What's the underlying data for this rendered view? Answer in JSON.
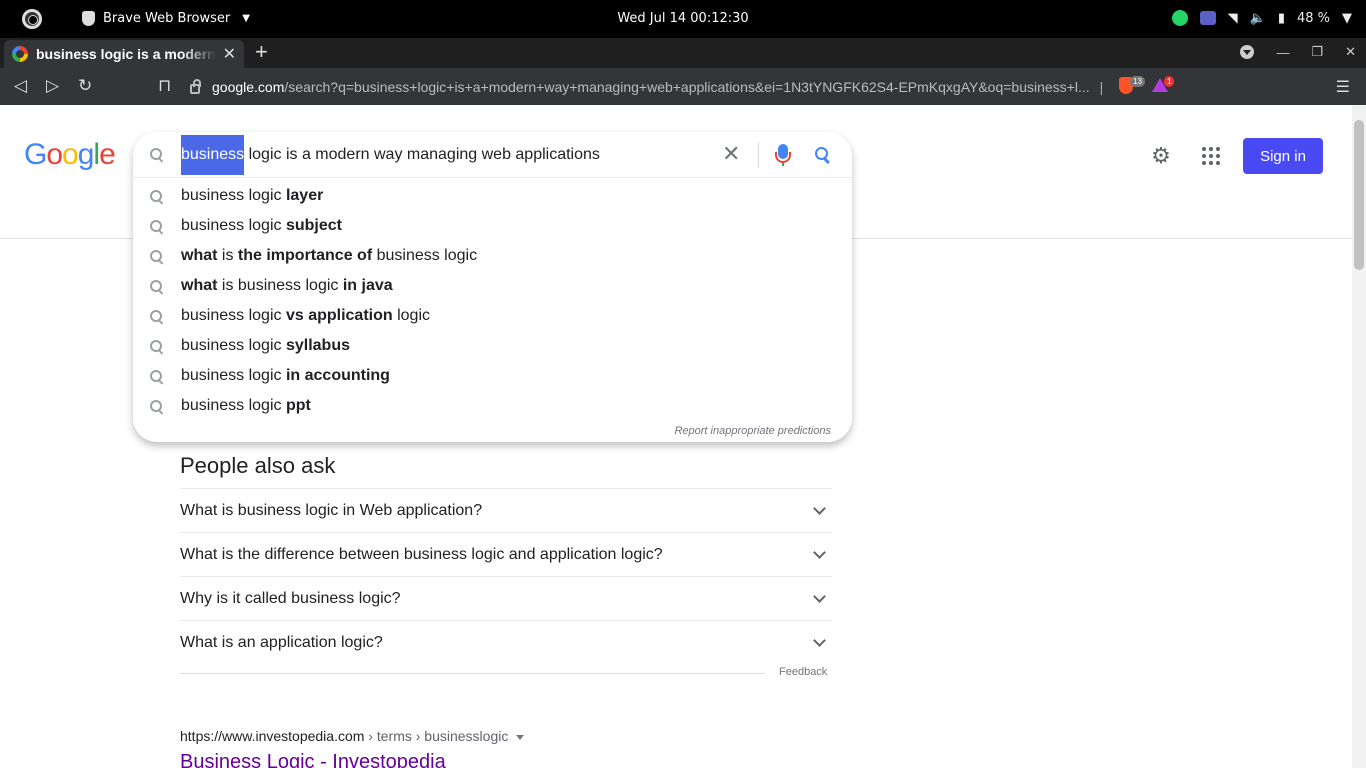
{
  "os": {
    "app_name": "Brave Web Browser",
    "clock": "Wed Jul 14  00:12:30",
    "battery": "48 %"
  },
  "browser": {
    "tab_title": "business logic is a modern way managing web applications",
    "url_host": "google.com",
    "url_rest": "/search?q=business+logic+is+a+modern+way+managing+web+applications&ei=1N3tYNGFK62S4-EPmKqxgAY&oq=business+l...",
    "shield_count": "13",
    "rewards_count": "1"
  },
  "google": {
    "logo_letters": [
      "G",
      "o",
      "o",
      "g",
      "l",
      "e"
    ],
    "sign_in": "Sign in",
    "query_selected": "business",
    "query_rest": " logic is a modern way managing web applications"
  },
  "suggestions": [
    {
      "parts": [
        {
          "t": "business logic ",
          "b": false
        },
        {
          "t": "layer",
          "b": true
        }
      ]
    },
    {
      "parts": [
        {
          "t": "business logic ",
          "b": false
        },
        {
          "t": "subject",
          "b": true
        }
      ]
    },
    {
      "parts": [
        {
          "t": "what",
          "b": true
        },
        {
          "t": " is ",
          "b": false
        },
        {
          "t": "the importance of",
          "b": true
        },
        {
          "t": " business logic",
          "b": false
        }
      ]
    },
    {
      "parts": [
        {
          "t": "what",
          "b": true
        },
        {
          "t": " is business logic ",
          "b": false
        },
        {
          "t": "in java",
          "b": true
        }
      ]
    },
    {
      "parts": [
        {
          "t": "business logic ",
          "b": false
        },
        {
          "t": "vs application",
          "b": true
        },
        {
          "t": " logic",
          "b": false
        }
      ]
    },
    {
      "parts": [
        {
          "t": "business logic ",
          "b": false
        },
        {
          "t": "syllabus",
          "b": true
        }
      ]
    },
    {
      "parts": [
        {
          "t": "business logic ",
          "b": false
        },
        {
          "t": "in accounting",
          "b": true
        }
      ]
    },
    {
      "parts": [
        {
          "t": "business logic ",
          "b": false
        },
        {
          "t": "ppt",
          "b": true
        }
      ]
    }
  ],
  "report_text": "Report inappropriate predictions",
  "paa": {
    "title": "People also ask",
    "questions": [
      "What is business logic in Web application?",
      "What is the difference between business logic and application logic?",
      "Why is it called business logic?",
      "What is an application logic?"
    ],
    "feedback": "Feedback"
  },
  "result": {
    "cite_host": "https://www.investopedia.com",
    "cite_path": " › terms › businesslogic",
    "title": "Business Logic - Investopedia"
  },
  "colors": {
    "sign_in_bg": "#4a4af4",
    "selection": "#4a69e8",
    "visited_link": "#660099"
  }
}
